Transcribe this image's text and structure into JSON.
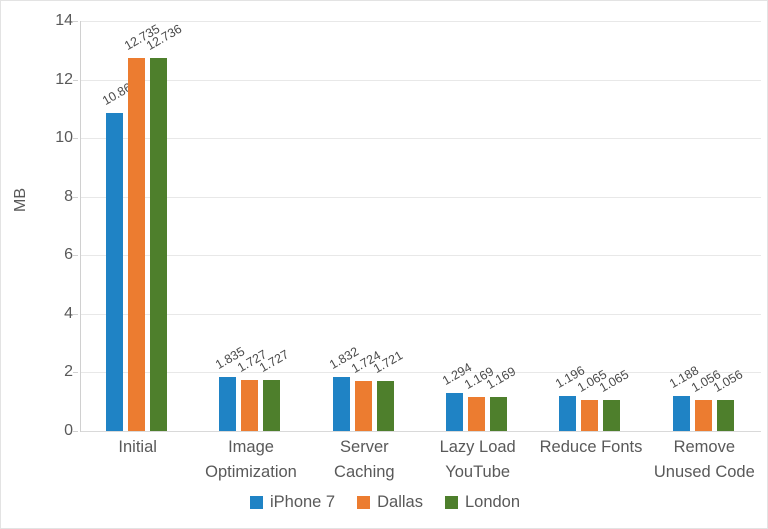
{
  "chart_data": {
    "type": "bar",
    "title": "",
    "subtitle": "",
    "xlabel": "",
    "ylabel": "MB",
    "ylim": [
      0,
      14
    ],
    "ytick_step": 2,
    "ytick_labels": [
      "0",
      "2",
      "4",
      "6",
      "8",
      "10",
      "12",
      "14"
    ],
    "grid": true,
    "legend_position": "bottom",
    "categories": [
      "Initial",
      "Image Optimization",
      "Server Caching",
      "Lazy Load YouTube",
      "Reduce Fonts",
      "Remove Unused Code"
    ],
    "category_lines": [
      [
        "Initial"
      ],
      [
        "Image",
        "Optimization"
      ],
      [
        "Server",
        "Caching"
      ],
      [
        "Lazy Load",
        "YouTube"
      ],
      [
        "Reduce Fonts"
      ],
      [
        "Remove",
        "Unused Code"
      ]
    ],
    "series": [
      {
        "name": "iPhone 7",
        "color": "#1f83c5",
        "values": [
          10.863,
          1.835,
          1.832,
          1.294,
          1.196,
          1.188
        ],
        "labels": [
          "10.863",
          "1.835",
          "1.832",
          "1.294",
          "1.196",
          "1.188"
        ]
      },
      {
        "name": "Dallas",
        "color": "#ec7c30",
        "values": [
          12.735,
          1.727,
          1.724,
          1.169,
          1.065,
          1.056
        ],
        "labels": [
          "12.735",
          "1.727",
          "1.724",
          "1.169",
          "1.065",
          "1.056"
        ]
      },
      {
        "name": "London",
        "color": "#4e7f2c",
        "values": [
          12.736,
          1.727,
          1.721,
          1.169,
          1.065,
          1.056
        ],
        "labels": [
          "12.736",
          "1.727",
          "1.721",
          "1.169",
          "1.065",
          "1.056"
        ]
      }
    ]
  },
  "colors": {
    "series_blue": "#1f83c5",
    "series_orange": "#ec7c30",
    "series_green": "#4e7f2c",
    "gridline": "#e8e8e8",
    "axis_text": "#595959",
    "label_text": "#4a4a4a",
    "frame": "#e3e3e3"
  }
}
